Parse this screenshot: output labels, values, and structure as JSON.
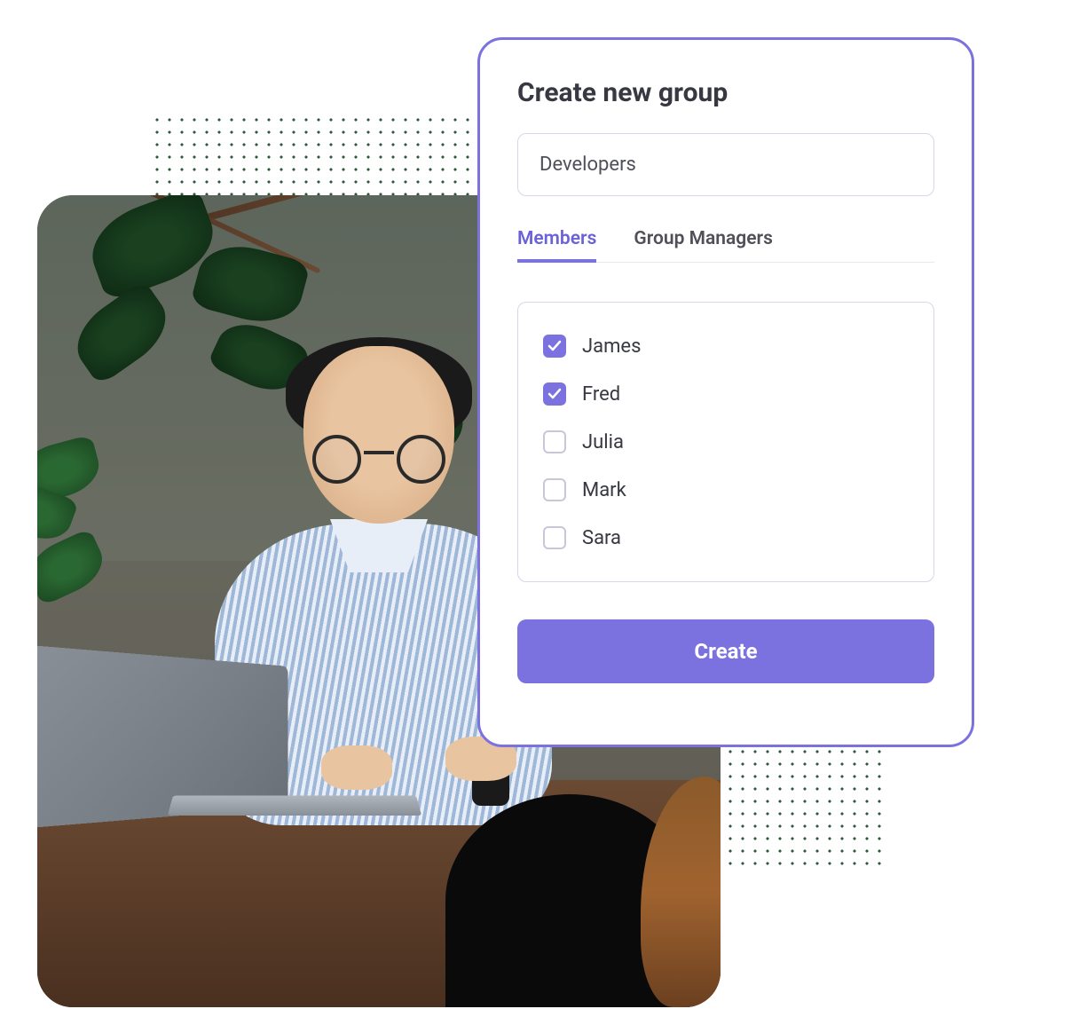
{
  "card": {
    "title": "Create new group",
    "group_name_value": "Developers",
    "tabs": [
      {
        "label": "Members",
        "active": true
      },
      {
        "label": "Group Managers",
        "active": false
      }
    ],
    "members": [
      {
        "name": "James",
        "checked": true
      },
      {
        "name": "Fred",
        "checked": true
      },
      {
        "name": "Julia",
        "checked": false
      },
      {
        "name": "Mark",
        "checked": false
      },
      {
        "name": "Sara",
        "checked": false
      }
    ],
    "create_label": "Create"
  },
  "colors": {
    "accent": "#7b72e0",
    "text_dark": "#373842",
    "border": "#d8d6e8"
  }
}
